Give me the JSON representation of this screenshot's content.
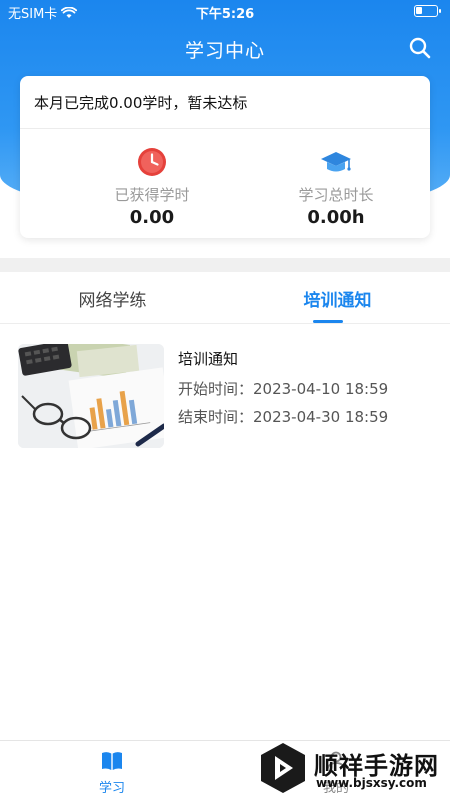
{
  "status_bar": {
    "carrier": "无SIM卡",
    "time": "下午5:26"
  },
  "nav": {
    "title": "学习中心",
    "search_icon": "search-icon"
  },
  "summary": {
    "headline": "本月已完成0.00学时，暂未达标",
    "stats": [
      {
        "label": "已获得学时",
        "value": "0.00",
        "icon": "clock-icon",
        "icon_color": "#e5413b"
      },
      {
        "label": "学习总时长",
        "value": "0.00h",
        "icon": "graduation-cap-icon",
        "icon_color": "#2e86de"
      }
    ]
  },
  "tabs": [
    {
      "label": "网络学练",
      "active": false
    },
    {
      "label": "培训通知",
      "active": true
    }
  ],
  "notices": [
    {
      "title": "培训通知",
      "start": "开始时间：2023-04-10 18:59",
      "end": "结束时间：2023-04-30 18:59",
      "thumbnail": "documents-calculator-glasses-photo"
    }
  ],
  "tabbar": [
    {
      "label": "学习",
      "icon": "book-icon",
      "active": true
    },
    {
      "label": "我的",
      "icon": "person-icon",
      "active": false
    }
  ],
  "watermark": {
    "name": "顺祥手游网",
    "url": "www.bjsxsy.com"
  },
  "colors": {
    "accent": "#1b86ee",
    "header_gradient_top": "#1b86ee",
    "header_gradient_bottom": "#5db2f7"
  }
}
